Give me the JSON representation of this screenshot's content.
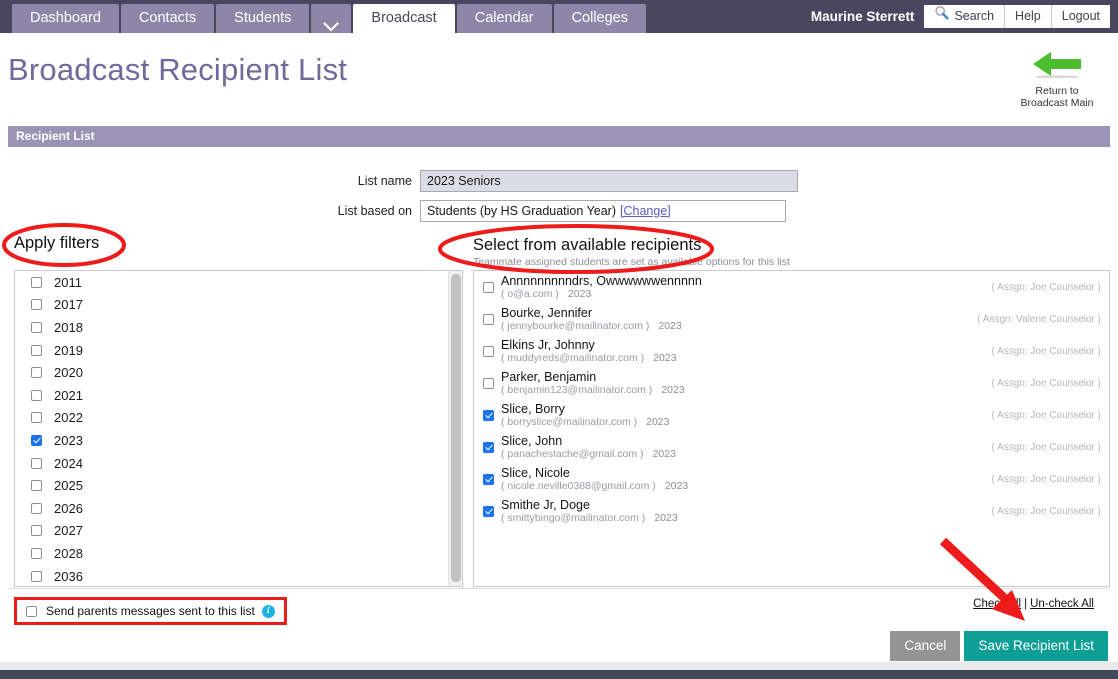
{
  "topnav": {
    "tabs": [
      {
        "label": "Dashboard",
        "active": false
      },
      {
        "label": "Contacts",
        "active": false
      },
      {
        "label": "Students",
        "active": false
      },
      {
        "label": "",
        "active": false,
        "icon": "chevron-down-icon"
      },
      {
        "label": "Broadcast",
        "active": true
      },
      {
        "label": "Calendar",
        "active": false
      },
      {
        "label": "Colleges",
        "active": false
      }
    ],
    "username": "Maurine Sterrett",
    "search_label": "Search",
    "help_label": "Help",
    "logout_label": "Logout"
  },
  "header": {
    "page_title": "Broadcast Recipient List",
    "return_line1": "Return to",
    "return_line2": "Broadcast Main",
    "section_bar": "Recipient List"
  },
  "form": {
    "list_name_label": "List name",
    "list_name_value": "2023 Seniors",
    "list_based_on_label": "List based on",
    "list_based_on_value": "Students (by HS Graduation Year)",
    "change_link": "[Change]"
  },
  "filters": {
    "heading": "Apply filters",
    "years": [
      {
        "label": "2011",
        "checked": false
      },
      {
        "label": "2017",
        "checked": false
      },
      {
        "label": "2018",
        "checked": false
      },
      {
        "label": "2019",
        "checked": false
      },
      {
        "label": "2020",
        "checked": false
      },
      {
        "label": "2021",
        "checked": false
      },
      {
        "label": "2022",
        "checked": false
      },
      {
        "label": "2023",
        "checked": true
      },
      {
        "label": "2024",
        "checked": false
      },
      {
        "label": "2025",
        "checked": false
      },
      {
        "label": "2026",
        "checked": false
      },
      {
        "label": "2027",
        "checked": false
      },
      {
        "label": "2028",
        "checked": false
      },
      {
        "label": "2036",
        "checked": false
      }
    ]
  },
  "recipients": {
    "heading": "Select from available recipients",
    "subheading": "Teammate assigned students are set as available options for this list",
    "rows": [
      {
        "name": "Annnnnnnnndrs, Owwwwwwennnnn",
        "email": "( o@a.com )",
        "year": "2023",
        "assign": "( Assgn: Joe Counselor )",
        "checked": false
      },
      {
        "name": "Bourke, Jennifer",
        "email": "( jennybourke@mailinator.com )",
        "year": "2023",
        "assign": "( Assgn: Valerie Counselor )",
        "checked": false
      },
      {
        "name": "Elkins Jr, Johnny",
        "email": "( muddyreds@mailinator.com )",
        "year": "2023",
        "assign": "( Assgn: Joe Counselor )",
        "checked": false
      },
      {
        "name": "Parker, Benjamin",
        "email": "( benjamin123@mailinator.com )",
        "year": "2023",
        "assign": "( Assgn: Joe Counselor )",
        "checked": false
      },
      {
        "name": "Slice, Borry",
        "email": "( borryslice@mailinator.com )",
        "year": "2023",
        "assign": "( Assgn: Joe Counselor )",
        "checked": true
      },
      {
        "name": "Slice, John",
        "email": "( panachestache@gmail.com )",
        "year": "2023",
        "assign": "( Assgn: Joe Counselor )",
        "checked": true
      },
      {
        "name": "Slice, Nicole",
        "email": "( nicole.neville0388@gmail.com )",
        "year": "2023",
        "assign": "( Assgn: Joe Counselor )",
        "checked": true
      },
      {
        "name": "Smithe Jr, Doge",
        "email": "( smittybingo@mailinator.com )",
        "year": "2023",
        "assign": "( Assgn: Joe Counselor )",
        "checked": true
      }
    ]
  },
  "bottom": {
    "send_parents_label": "Send parents messages sent to this list",
    "send_parents_checked": false,
    "check_all": "Check All",
    "uncheck_all": "Un-check All",
    "separator": "|",
    "cancel_label": "Cancel",
    "save_label": "Save Recipient List"
  },
  "colors": {
    "nav_bg": "#4b4660",
    "tab_bg": "#8d86a8",
    "title": "#6f6a9b",
    "section_bar": "#9a93b6",
    "checkbox_on": "#1a73e8",
    "save_button": "#0d9e96",
    "cancel_button": "#949494",
    "annotation_red": "#ee1b1b",
    "return_arrow_green": "#4cbb2c"
  }
}
